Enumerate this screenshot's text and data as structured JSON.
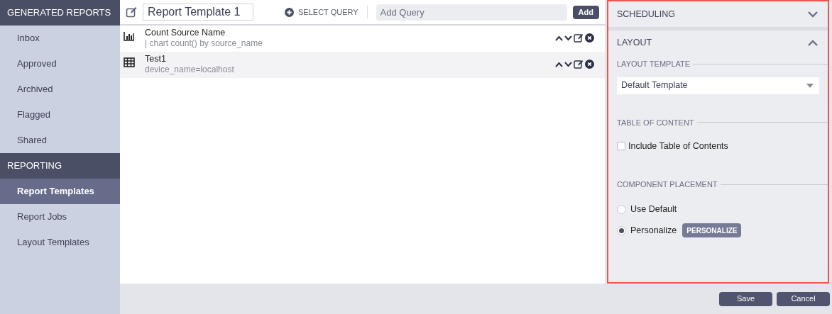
{
  "sidebar": {
    "sections": [
      {
        "title": "GENERATED REPORTS",
        "items": [
          {
            "label": "Inbox",
            "selected": false
          },
          {
            "label": "Approved",
            "selected": false
          },
          {
            "label": "Archived",
            "selected": false
          },
          {
            "label": "Flagged",
            "selected": false
          },
          {
            "label": "Shared",
            "selected": false
          }
        ]
      },
      {
        "title": "REPORTING",
        "items": [
          {
            "label": "Report Templates",
            "selected": true
          },
          {
            "label": "Report Jobs",
            "selected": false
          },
          {
            "label": "Layout Templates",
            "selected": false
          }
        ]
      }
    ]
  },
  "toolbar": {
    "template_name": "Report Template 1",
    "select_query": "SELECT QUERY",
    "query_field": {
      "placeholder": "Add Query"
    },
    "add_button": "Add"
  },
  "queries": [
    {
      "kind": "chart",
      "title": "Count Source Name",
      "query": "| chart count() by source_name"
    },
    {
      "kind": "table",
      "title": "Test1",
      "query": "device_name=localhost"
    }
  ],
  "panel": {
    "sections": [
      {
        "title": "SCHEDULING",
        "expanded": false
      },
      {
        "title": "LAYOUT",
        "expanded": true
      }
    ],
    "layout_template": {
      "label": "LAYOUT TEMPLATE",
      "value": "Default Template"
    },
    "table_of_content": {
      "label": "TABLE OF CONTENT",
      "checkbox": {
        "label": "Include Table of Contents",
        "checked": false
      }
    },
    "component_placement": {
      "label": "COMPONENT PLACEMENT",
      "options": [
        {
          "label": "Use Default",
          "selected": false
        },
        {
          "label": "Personalize",
          "selected": true
        }
      ],
      "personalize_button": "PERSONALIZE"
    }
  },
  "footer": {
    "buttons": [
      "Save",
      "Cancel"
    ]
  }
}
